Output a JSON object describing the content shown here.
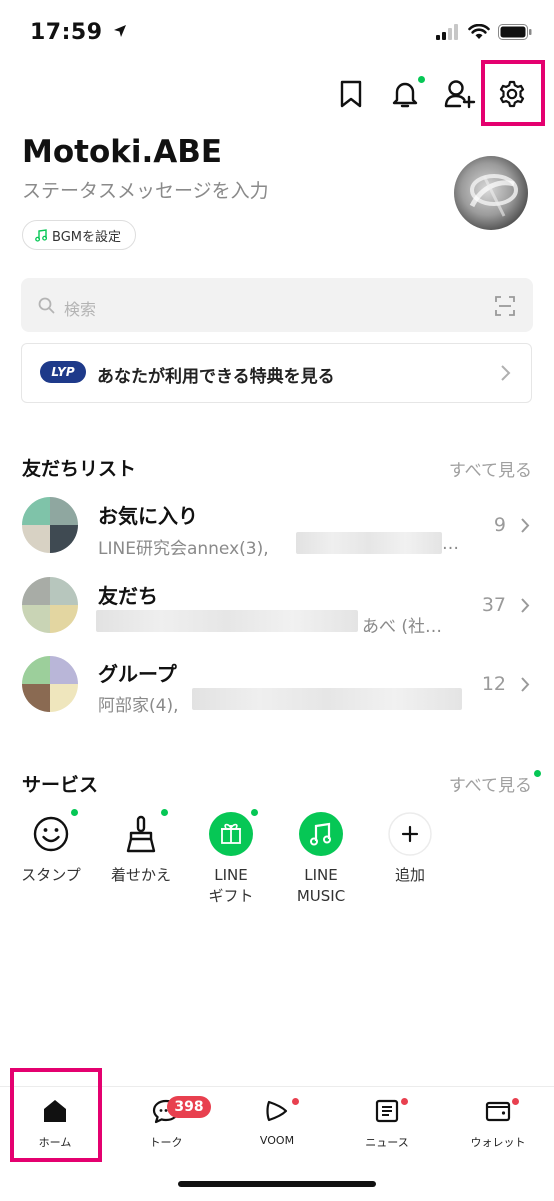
{
  "status_bar": {
    "time": "17:59"
  },
  "header": {
    "icons": [
      "bookmark-icon",
      "bell-icon",
      "add-friend-icon",
      "settings-icon"
    ]
  },
  "profile": {
    "name": "Motoki.ABE",
    "status_placeholder": "ステータスメッセージを入力",
    "bgm_label": "BGMを設定"
  },
  "search": {
    "placeholder": "検索"
  },
  "promo": {
    "badge": "LYP",
    "text": "あなたが利用できる特典を見る"
  },
  "friends_section": {
    "title": "友だちリスト",
    "see_all": "すべて見る",
    "rows": [
      {
        "title": "お気に入り",
        "subtitle": "LINE研究会annex(3), ",
        "subtitle_tail": "…",
        "count": "9"
      },
      {
        "title": "友だち",
        "subtitle": "あべ (社…",
        "count": "37"
      },
      {
        "title": "グループ",
        "subtitle": "阿部家(4), ",
        "count": "12"
      }
    ]
  },
  "services_section": {
    "title": "サービス",
    "see_all": "すべて見る",
    "items": [
      {
        "label": "スタンプ",
        "icon": "smiley-icon"
      },
      {
        "label": "着せかえ",
        "icon": "brush-icon"
      },
      {
        "label_line1": "LINE",
        "label_line2": "ギフト",
        "icon": "gift-icon"
      },
      {
        "label_line1": "LINE",
        "label_line2": "MUSIC",
        "icon": "music-icon"
      },
      {
        "label": "追加",
        "icon": "plus-icon"
      }
    ]
  },
  "tabbar": {
    "tabs": [
      {
        "label": "ホーム",
        "icon": "home-icon"
      },
      {
        "label": "トーク",
        "icon": "chat-icon",
        "badge": "398"
      },
      {
        "label": "VOOM",
        "icon": "voom-icon"
      },
      {
        "label": "ニュース",
        "icon": "news-icon"
      },
      {
        "label": "ウォレット",
        "icon": "wallet-icon"
      }
    ]
  },
  "colors": {
    "line_green": "#06c755",
    "badge_red": "#e8404f",
    "highlight": "#e4006f",
    "lyp_blue": "#1e3a8a"
  }
}
